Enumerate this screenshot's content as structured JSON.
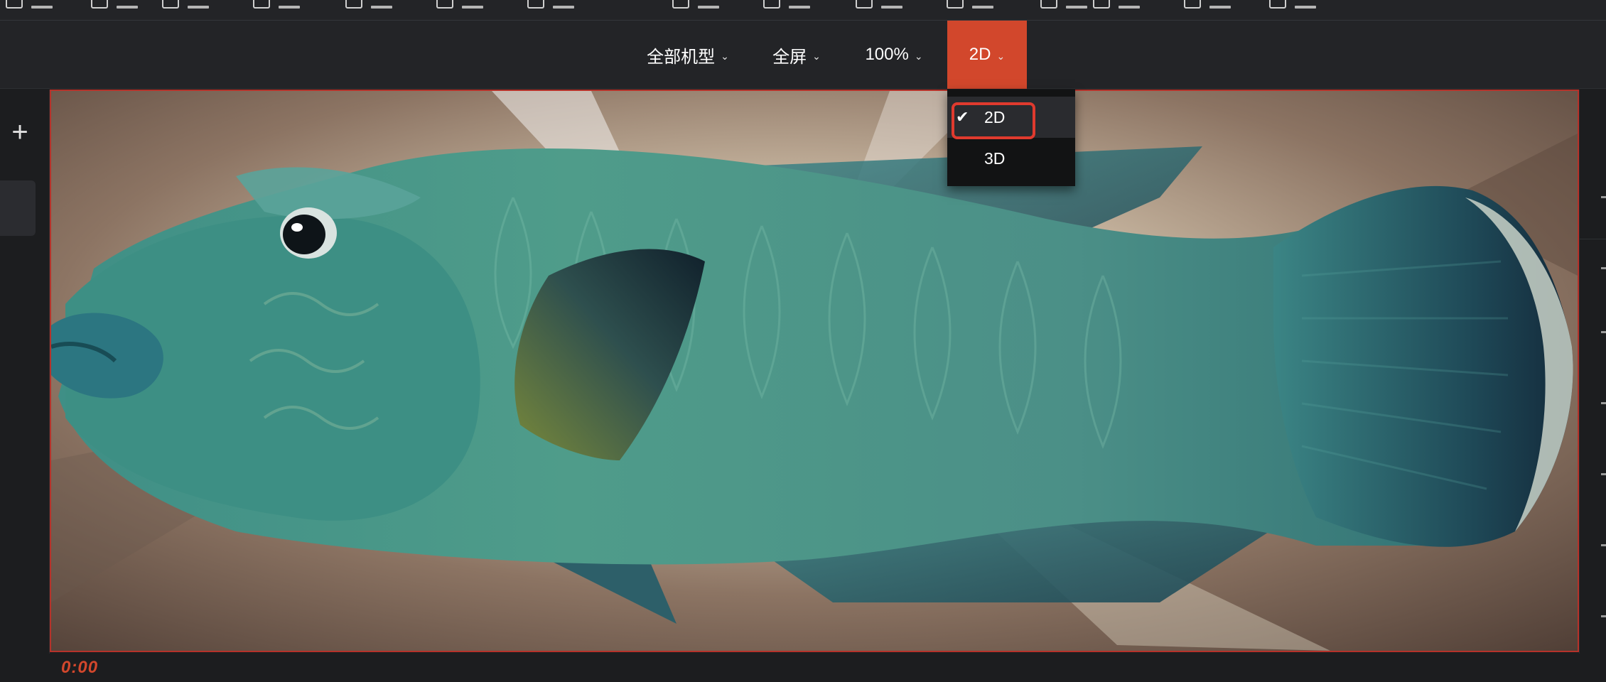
{
  "toolbar": {
    "device_label": "全部机型",
    "fullscreen_label": "全屏",
    "zoom_label": "100%",
    "mode_label": "2D"
  },
  "dropdown": {
    "options": [
      {
        "label": "2D",
        "selected": true
      },
      {
        "label": "3D",
        "selected": false
      }
    ]
  },
  "timeline": {
    "time": "0:00"
  },
  "colors": {
    "accent": "#d2472c",
    "highlight": "#e03a2e",
    "background": "#1c1d1f",
    "toolbar": "#232427"
  },
  "icons": {
    "add": "plus-icon",
    "chevron": "chevron-down-icon",
    "check": "check-icon"
  }
}
